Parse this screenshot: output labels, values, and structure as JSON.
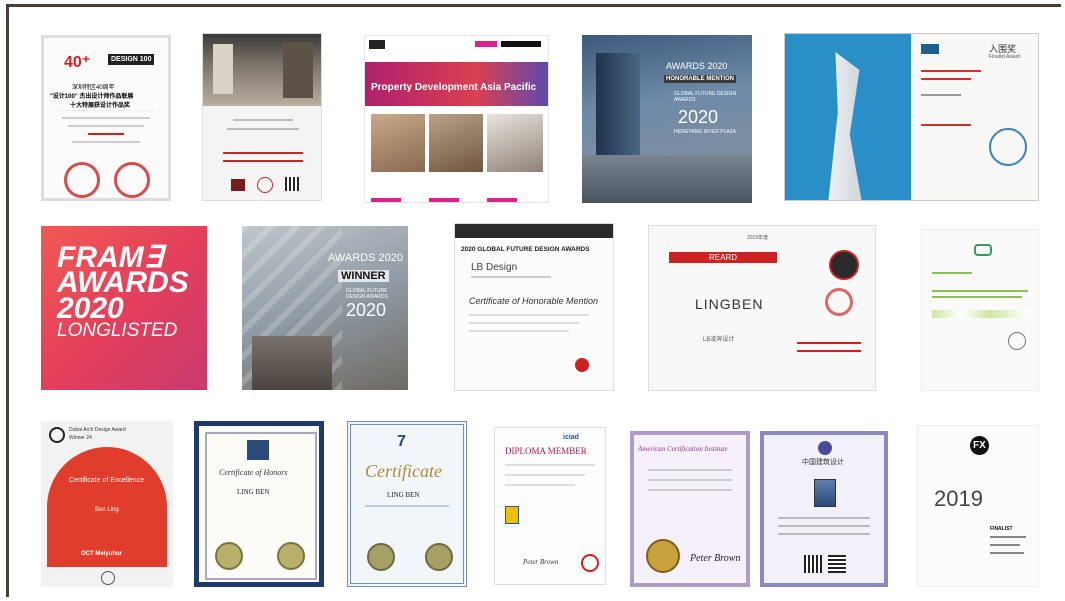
{
  "tiles": {
    "t1": {
      "top": "40⁺",
      "logo": "DESIGN 100",
      "cn1": "深圳特区40周年",
      "cn2": "\"设计100\" 杰出设计师作品联展",
      "cn3": "十大特展获设计作品奖"
    },
    "t3": {
      "headline": "Property Development Asia Pacific"
    },
    "t4": {
      "awards": "AWARDS 2020",
      "mention": "HONORABLE MENTION",
      "gfda": "GLOBAL FUTURE DESIGN AWARDS",
      "year": "2020",
      "project": "HENGYANG RIVER PLAZA"
    },
    "t5": {
      "title": "入围奖",
      "subtitle": "Finalist Award"
    },
    "t6": {
      "l1": "FRAM∃",
      "l2": "AWARDS",
      "l3": "2020",
      "l4": "LONGLISTED"
    },
    "t7": {
      "awards": "AWARDS 2020",
      "winner": "WINNER",
      "gfda": "GLOBAL FUTURE DESIGN AWARDS",
      "year": "2020"
    },
    "t8": {
      "header": "2020 GLOBAL FUTURE DESIGN AWARDS",
      "name": "LB Design",
      "cert": "Certificate of Honorable Mention"
    },
    "t9": {
      "year": "2019年度",
      "badge": "REARD",
      "brand": "LINGBEN",
      "cn": "LB凌奔设计"
    },
    "t11": {
      "brand": "Dubai Arch Design Award",
      "sub": "Winner 24",
      "cert": "Certificate of Excellence",
      "name": "Ben Ling",
      "foot": "OCT Meiyuhur"
    },
    "t12": {
      "cert": "Certificate of Honors",
      "name": "LING BEN"
    },
    "t13": {
      "cert": "Certificate",
      "name": "LING BEN"
    },
    "t14": {
      "logo": "iciad",
      "title": "DIPLOMA MEMBER",
      "signer": "Peter Brown"
    },
    "t15": {
      "title": "American Certification Institute",
      "signer": "Peter Brown"
    },
    "t16": {
      "title": "中国建筑设计"
    },
    "t17": {
      "logo": "FX",
      "year": "2019",
      "label": "FINALIST"
    }
  }
}
